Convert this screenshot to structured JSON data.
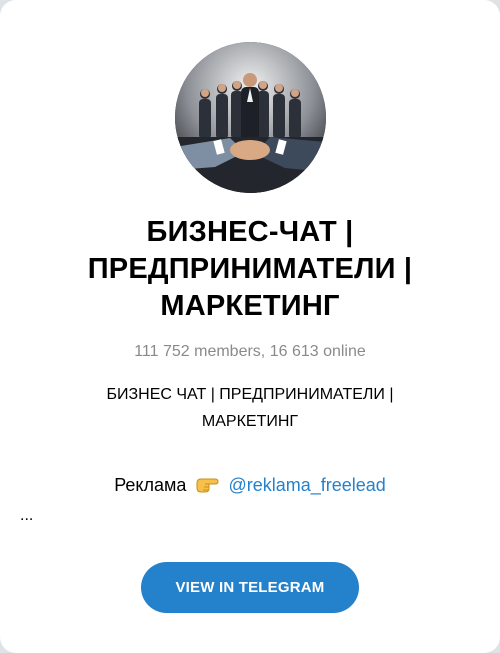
{
  "channel": {
    "title": "БИЗНЕС-ЧАТ | ПРЕДПРИНИМАТЕЛИ | МАРКЕТИНГ",
    "members_text": "111 752 members, 16 613 online",
    "description_line1": "БИЗНЕС ЧАТ | ПРЕДПРИНИМАТЕЛИ |",
    "description_line2": "МАРКЕТИНГ",
    "ad_label": "Реклама",
    "ad_emoji": "pointing-hand-icon",
    "ad_link": "@reklama_freelead",
    "ellipsis": "..."
  },
  "actions": {
    "view_button_label": "VIEW IN TELEGRAM"
  },
  "colors": {
    "accent": "#2481cc",
    "muted": "#8a8a8a",
    "card_background": "#ffffff",
    "page_background": "#dfe3e8"
  }
}
